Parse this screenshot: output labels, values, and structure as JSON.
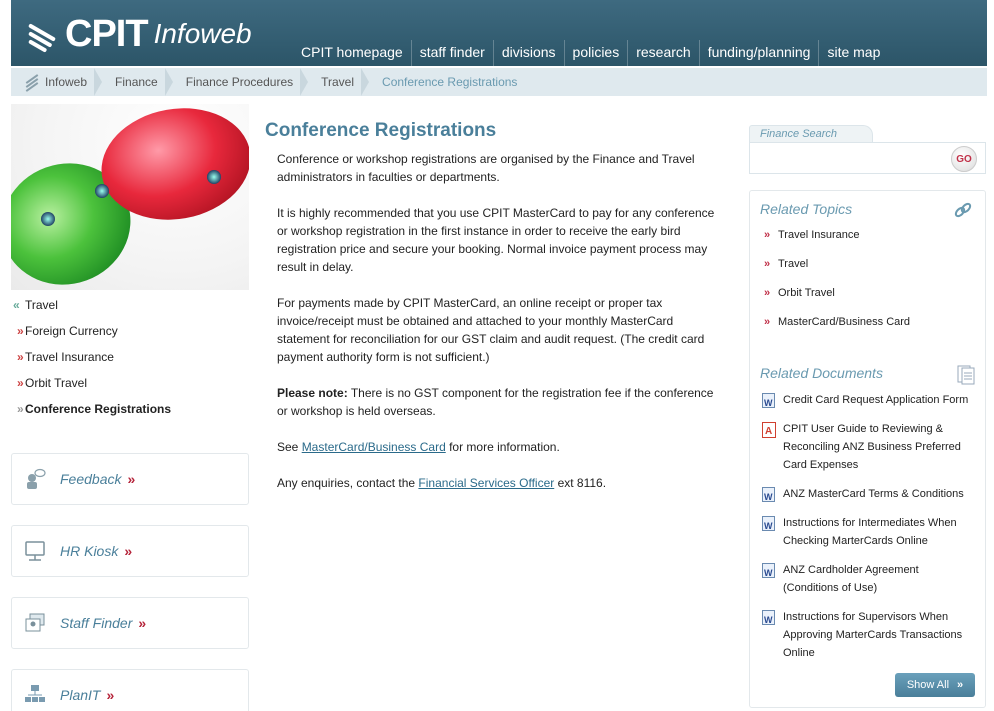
{
  "header": {
    "logo_text": "CPIT",
    "logo_sub": "Infoweb",
    "nav": [
      "CPIT homepage",
      "staff finder",
      "divisions",
      "policies",
      "research",
      "funding/planning",
      "site map"
    ]
  },
  "breadcrumb": [
    "Infoweb",
    "Finance",
    "Finance Procedures",
    "Travel",
    "Conference Registrations"
  ],
  "leftnav": {
    "parent": "Travel",
    "items": [
      "Foreign Currency",
      "Travel Insurance",
      "Orbit Travel",
      "Conference Registrations"
    ]
  },
  "promos": [
    "Feedback",
    "HR Kiosk",
    "Staff Finder",
    "PlanIT"
  ],
  "main": {
    "title": "Conference Registrations",
    "p1": "Conference or workshop registrations are organised by the Finance and Travel administrators in faculties or departments.",
    "p2": "It is highly recommended that you use CPIT MasterCard to pay for any conference or workshop registration in the first instance in order to receive the early bird registration price and secure your booking. Normal invoice payment process may result in delay.",
    "p3": "For payments made by CPIT MasterCard, an online receipt or proper tax invoice/receipt must be obtained and attached to your monthly MasterCard statement for reconciliation for our GST claim and audit request. (The credit card payment authority form is not sufficient.)",
    "note_label": "Please note:",
    "note_text": " There is no GST component for the registration fee if the conference or workshop is held overseas.",
    "see_prefix": "See ",
    "see_link": "MasterCard/Business Card",
    "see_suffix": " for more information.",
    "enq_prefix": "Any enquiries, contact the ",
    "enq_link": "Financial Services Officer",
    "enq_suffix": " ext 8116."
  },
  "search": {
    "tab_label": "Finance Search",
    "placeholder": "",
    "go_label": "GO"
  },
  "related_topics": {
    "heading": "Related Topics",
    "items": [
      "Travel Insurance",
      "Travel",
      "Orbit Travel",
      "MasterCard/Business Card"
    ]
  },
  "related_documents": {
    "heading": "Related Documents",
    "items": [
      {
        "type": "word",
        "text": "Credit Card Request Application Form"
      },
      {
        "type": "pdf",
        "text": "CPIT User Guide to Reviewing & Reconciling ANZ Business Preferred Card Expenses"
      },
      {
        "type": "word",
        "text": "ANZ MasterCard Terms & Conditions"
      },
      {
        "type": "word",
        "text": "Instructions for Intermediates When Checking MarterCards Online"
      },
      {
        "type": "word",
        "text": "ANZ Cardholder Agreement (Conditions of Use)"
      },
      {
        "type": "word",
        "text": "Instructions for Supervisors When Approving MarterCards Transactions Online"
      }
    ],
    "show_all": "Show All"
  },
  "colors": {
    "header_bg": "#2c5568",
    "accent_blue": "#4a7f9a",
    "accent_red": "#c03048"
  }
}
